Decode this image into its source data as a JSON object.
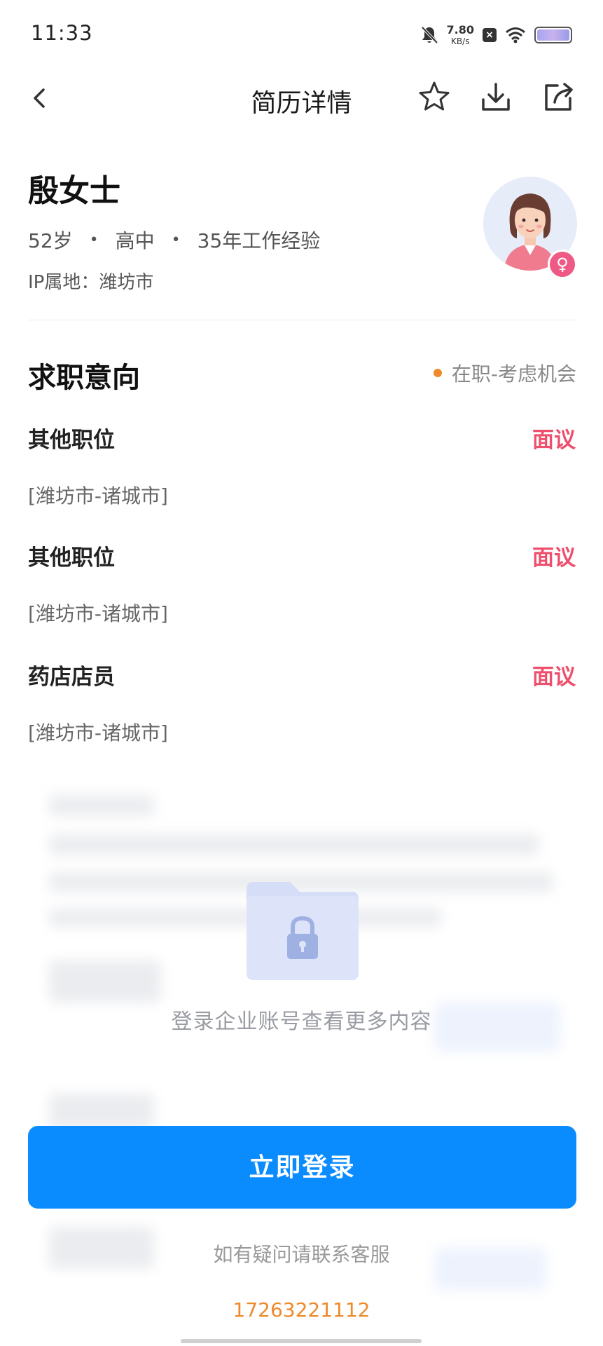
{
  "status_bar": {
    "time": "11:33",
    "net_speed_value": "7.80",
    "net_speed_unit": "KB/s"
  },
  "nav": {
    "title": "简历详情",
    "icons": [
      "back-icon",
      "star-icon",
      "download-icon",
      "share-icon"
    ]
  },
  "profile": {
    "name": "殷女士",
    "age": "52岁",
    "education": "高中",
    "experience": "35年工作经验",
    "ip_location": "IP属地：潍坊市",
    "gender_symbol": "♀"
  },
  "intention": {
    "title": "求职意向",
    "status": "在职-考虑机会",
    "jobs": [
      {
        "title": "其他职位",
        "salary": "面议",
        "location": "[潍坊市-诸城市]"
      },
      {
        "title": "其他职位",
        "salary": "面议",
        "location": "[潍坊市-诸城市]"
      },
      {
        "title": "药店店员",
        "salary": "面议",
        "location": "[潍坊市-诸城市]"
      }
    ]
  },
  "locked": {
    "message": "登录企业账号查看更多内容",
    "login_label": "立即登录",
    "help_text": "如有疑问请联系客服",
    "phone": "17263221112"
  },
  "colors": {
    "accent": "#0a8cff",
    "salary": "#ee4f6d",
    "status_dot": "#f08a28",
    "phone": "#ef8a2c"
  }
}
